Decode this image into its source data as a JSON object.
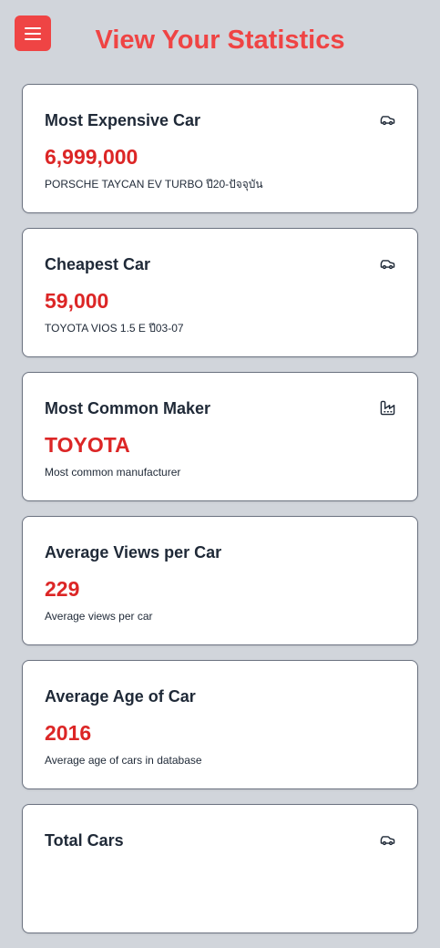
{
  "header": {
    "title": "View Your Statistics",
    "menu_icon": "hamburger-menu-icon",
    "accent_color": "#ef4444"
  },
  "cards": [
    {
      "title": "Most Expensive Car",
      "value": "6,999,000",
      "description": "PORSCHE TAYCAN EV TURBO ปี20-ปัจจุบัน",
      "icon": "car-icon"
    },
    {
      "title": "Cheapest Car",
      "value": "59,000",
      "description": "TOYOTA VIOS 1.5 E ปี03-07",
      "icon": "car-icon"
    },
    {
      "title": "Most Common Maker",
      "value": "TOYOTA",
      "description": "Most common manufacturer",
      "icon": "factory-icon"
    },
    {
      "title": "Average Views per Car",
      "value": "229",
      "description": "Average views per car",
      "icon": ""
    },
    {
      "title": "Average Age of Car",
      "value": "2016",
      "description": "Average age of cars in database",
      "icon": ""
    },
    {
      "title": "Total Cars",
      "value": "",
      "description": "",
      "icon": "car-icon"
    }
  ]
}
